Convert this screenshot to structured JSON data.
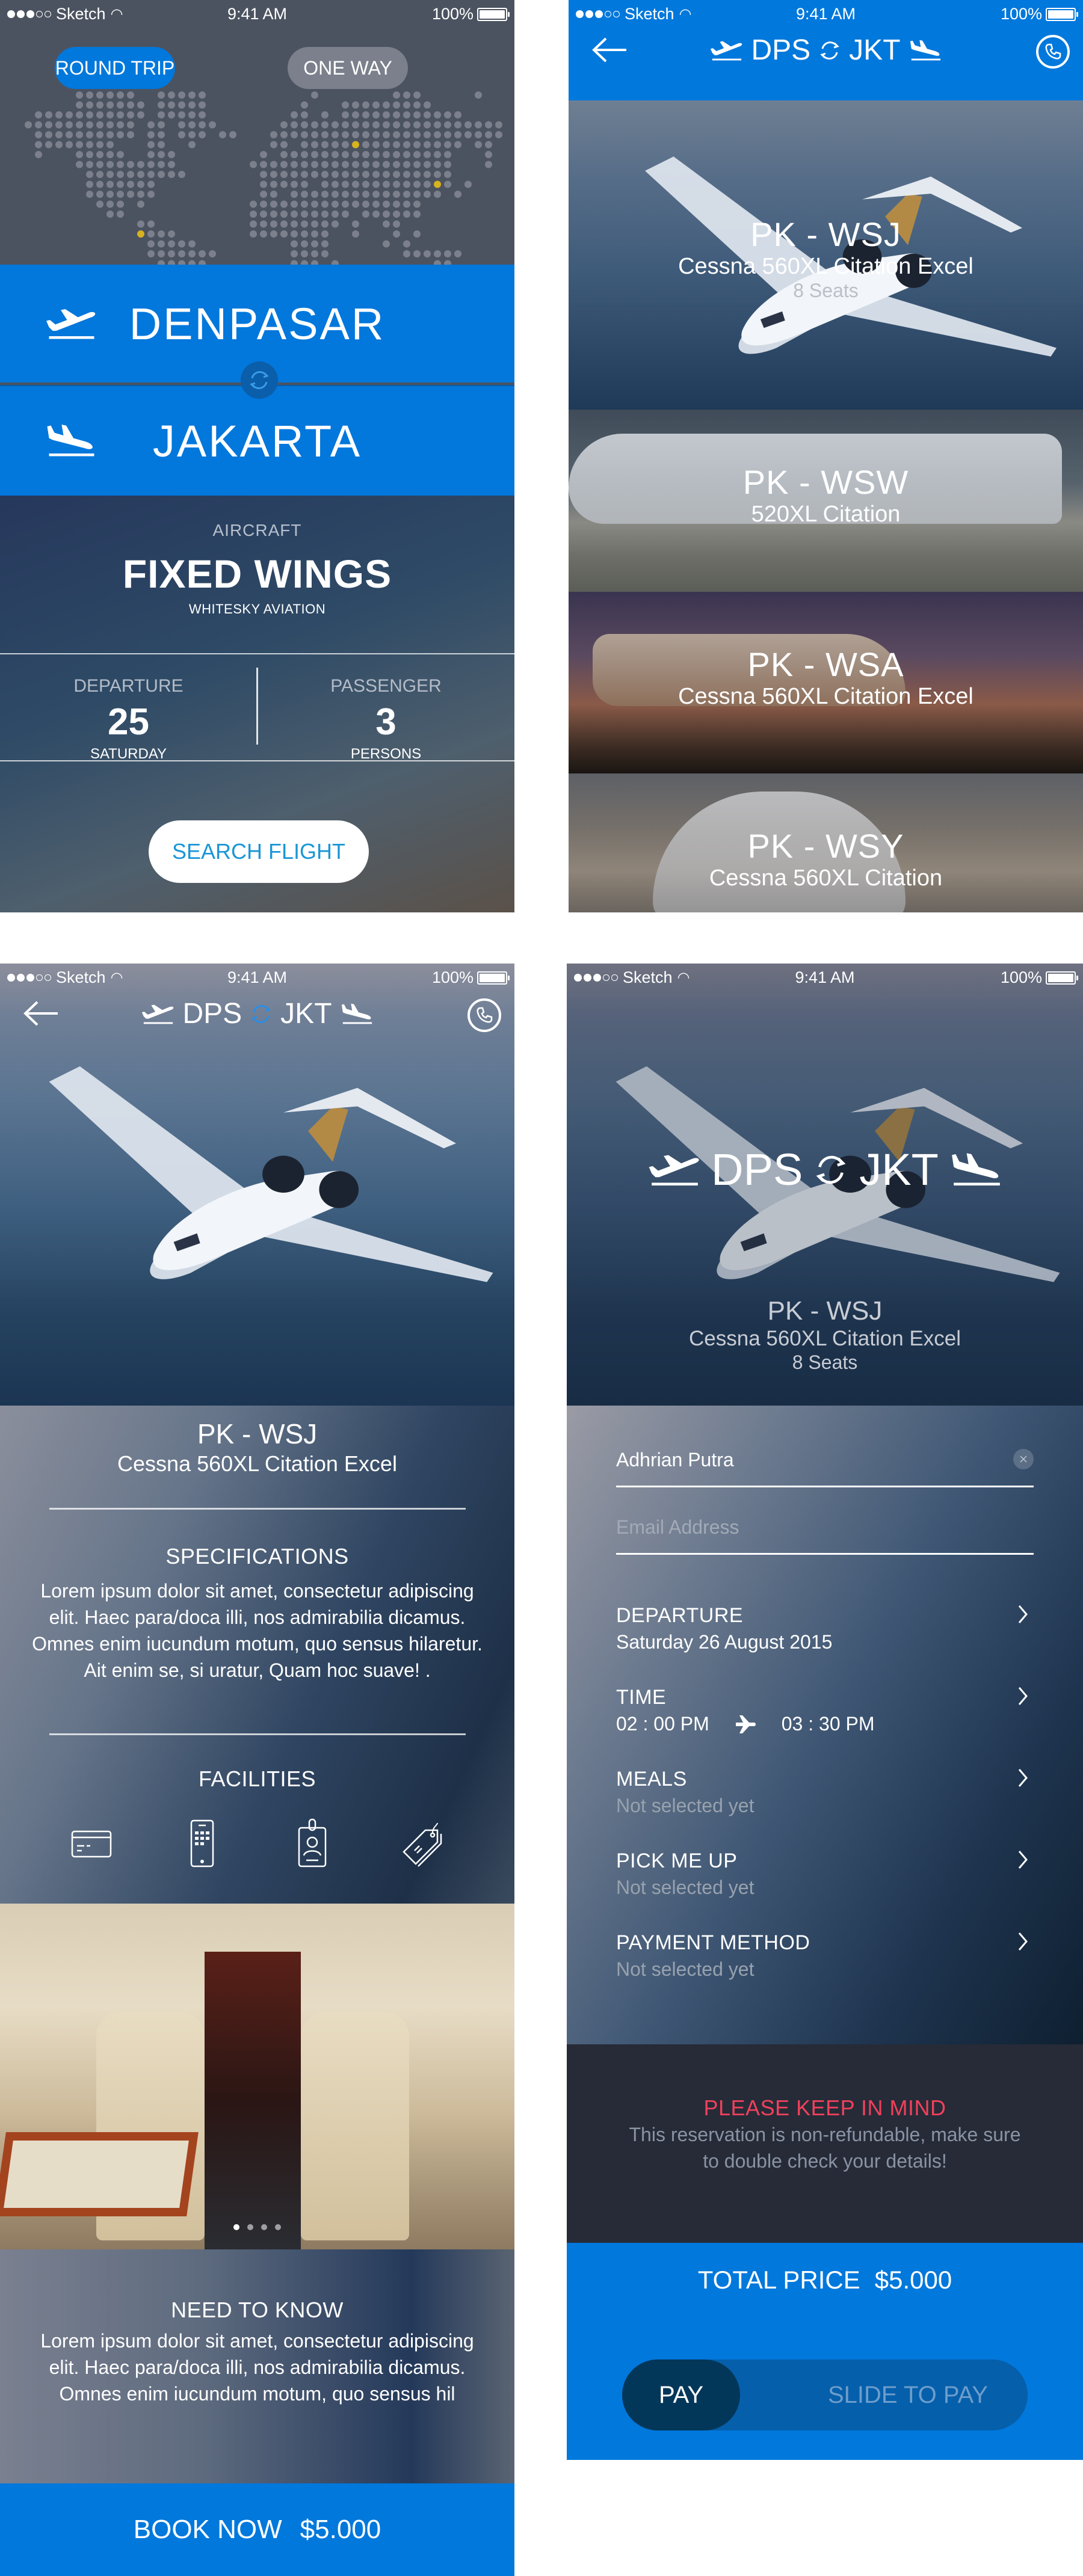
{
  "status_bar": {
    "carrier": "Sketch",
    "time": "9:41 AM",
    "battery": "100%",
    "signal_bars_filled": 3,
    "signal_bars_total": 5
  },
  "colors": {
    "accent_blue": "#0178dc",
    "warning_red": "#f1405c",
    "map_dot": "#7b808c",
    "map_highlight": "#d6b21f"
  },
  "search_screen": {
    "trip_types": [
      {
        "label": "ROUND TRIP",
        "selected": true
      },
      {
        "label": "ONE WAY",
        "selected": false
      }
    ],
    "from": {
      "city": "DENPASAR",
      "icon": "plane-takeoff-icon"
    },
    "to": {
      "city": "JAKARTA",
      "icon": "plane-landing-icon"
    },
    "swap_icon": "swap-icon",
    "aircraft": {
      "label": "AIRCRAFT",
      "type": "FIXED WINGS",
      "operator": "WHITESKY AVIATION"
    },
    "departure": {
      "label": "DEPARTURE",
      "day": "25",
      "weekday": "SATURDAY"
    },
    "passenger": {
      "label": "PASSENGER",
      "count": "3",
      "unit": "PERSONS"
    },
    "search_button": "SEARCH FLIGHT"
  },
  "results_screen": {
    "route": {
      "from_code": "DPS",
      "to_code": "JKT"
    },
    "aircraft": [
      {
        "registration": "PK - WSJ",
        "model": "Cessna 560XL Citation Excel",
        "seats": "8 Seats"
      },
      {
        "registration": "PK - WSW",
        "model": "520XL Citation"
      },
      {
        "registration": "PK - WSA",
        "model": "Cessna 560XL Citation Excel"
      },
      {
        "registration": "PK - WSY",
        "model": "Cessna 560XL Citation"
      }
    ]
  },
  "detail_screen": {
    "route": {
      "from_code": "DPS",
      "to_code": "JKT"
    },
    "registration": "PK - WSJ",
    "model": "Cessna 560XL Citation Excel",
    "specifications": {
      "title": "SPECIFICATIONS",
      "text": "Lorem ipsum dolor sit amet, consectetur adipiscing elit. Haec para/doca illi, nos admirabilia dicamus. Omnes enim iucundum motum, quo sensus hilaretur. Ait enim se, si uratur, Quam hoc suave! ."
    },
    "facilities": {
      "title": "FACILITIES",
      "icons": [
        "credit-card-icon",
        "mobile-phone-icon",
        "id-badge-icon",
        "price-tag-icon"
      ]
    },
    "gallery": {
      "count": 4,
      "active_index": 0
    },
    "need_to_know": {
      "title": "NEED TO KNOW",
      "text": "Lorem ipsum dolor sit amet, consectetur adipiscing elit. Haec para/doca illi, nos admirabilia dicamus. Omnes enim iucundum motum, quo sensus hil"
    },
    "book_button": {
      "label": "BOOK NOW",
      "price": "$5.000"
    }
  },
  "checkout_screen": {
    "route": {
      "from_code": "DPS",
      "to_code": "JKT"
    },
    "registration": "PK - WSJ",
    "model": "Cessna 560XL Citation Excel",
    "seats": "8 Seats",
    "name_field": {
      "value": "Adhrian Putra"
    },
    "email_field": {
      "value": "",
      "placeholder": "Email Address"
    },
    "options": [
      {
        "title": "DEPARTURE",
        "value": "Saturday 26 August 2015",
        "muted": false
      },
      {
        "title": "TIME",
        "depart": "02 : 00 PM",
        "arrive": "03 : 30 PM"
      },
      {
        "title": "MEALS",
        "value": "Not selected yet",
        "muted": true
      },
      {
        "title": "PICK ME UP",
        "value": "Not selected yet",
        "muted": true
      },
      {
        "title": "PAYMENT METHOD",
        "value": "Not selected yet",
        "muted": true
      }
    ],
    "notice": {
      "title": "PLEASE KEEP IN MIND",
      "text": "This reservation is non-refundable, make sure to double check your details!"
    },
    "total": {
      "label": "TOTAL PRICE",
      "amount": "$5.000"
    },
    "slider": {
      "knob_label": "PAY",
      "track_label": "SLIDE TO PAY",
      "progress": 0
    }
  }
}
